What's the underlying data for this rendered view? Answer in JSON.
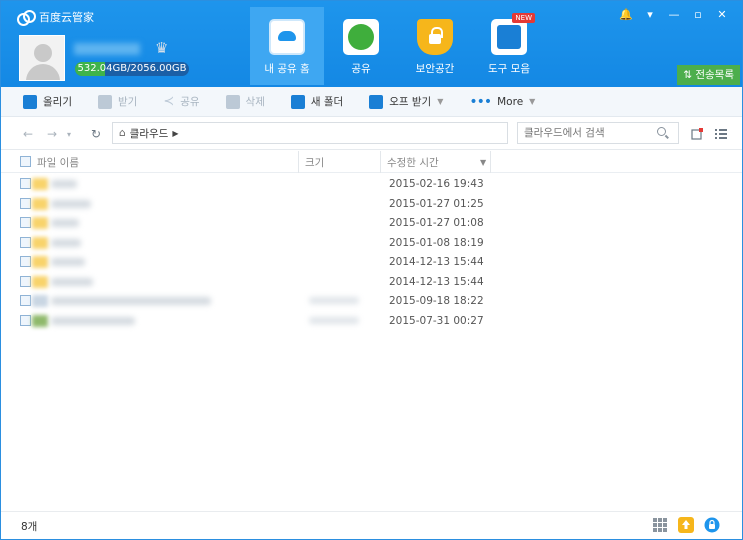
{
  "app": {
    "title": "百度云管家"
  },
  "user": {
    "quota_text": "532.04GB/2056.00GB",
    "quota_used_fraction": 0.259
  },
  "nav": [
    {
      "label": "내 공유 홈",
      "icon": "cloud-icon",
      "active": true
    },
    {
      "label": "공유",
      "icon": "share-icon"
    },
    {
      "label": "보안공간",
      "icon": "lock-icon"
    },
    {
      "label": "도구 모음",
      "icon": "tools-icon",
      "badge": "NEW"
    }
  ],
  "window": {
    "transfer_label": "전송목록"
  },
  "toolbar": {
    "upload": "올리기",
    "download": "받기",
    "share": "공유",
    "delete": "삭제",
    "new_folder": "새 폴더",
    "offline_download": "오프 받기",
    "more": "More"
  },
  "address": {
    "path": "클라우드",
    "search_placeholder": "클라우드에서 검색"
  },
  "table": {
    "headers": {
      "name": "파일 이름",
      "size": "크기",
      "modified": "수정한 시간"
    },
    "rows": [
      {
        "date": "2015-02-16 19:43",
        "type": "folder"
      },
      {
        "date": "2015-01-27 01:25",
        "type": "folder"
      },
      {
        "date": "2015-01-27 01:08",
        "type": "folder"
      },
      {
        "date": "2015-01-08 18:19",
        "type": "folder"
      },
      {
        "date": "2014-12-13 15:44",
        "type": "folder"
      },
      {
        "date": "2014-12-13 15:44",
        "type": "folder"
      },
      {
        "date": "2015-09-18 18:22",
        "type": "file"
      },
      {
        "date": "2015-07-31 00:27",
        "type": "file"
      }
    ]
  },
  "status": {
    "count": "8개"
  },
  "colors": {
    "brand": "#1e95ec",
    "transfer": "#4cae4c",
    "quota_fill": "#3fb34a"
  }
}
